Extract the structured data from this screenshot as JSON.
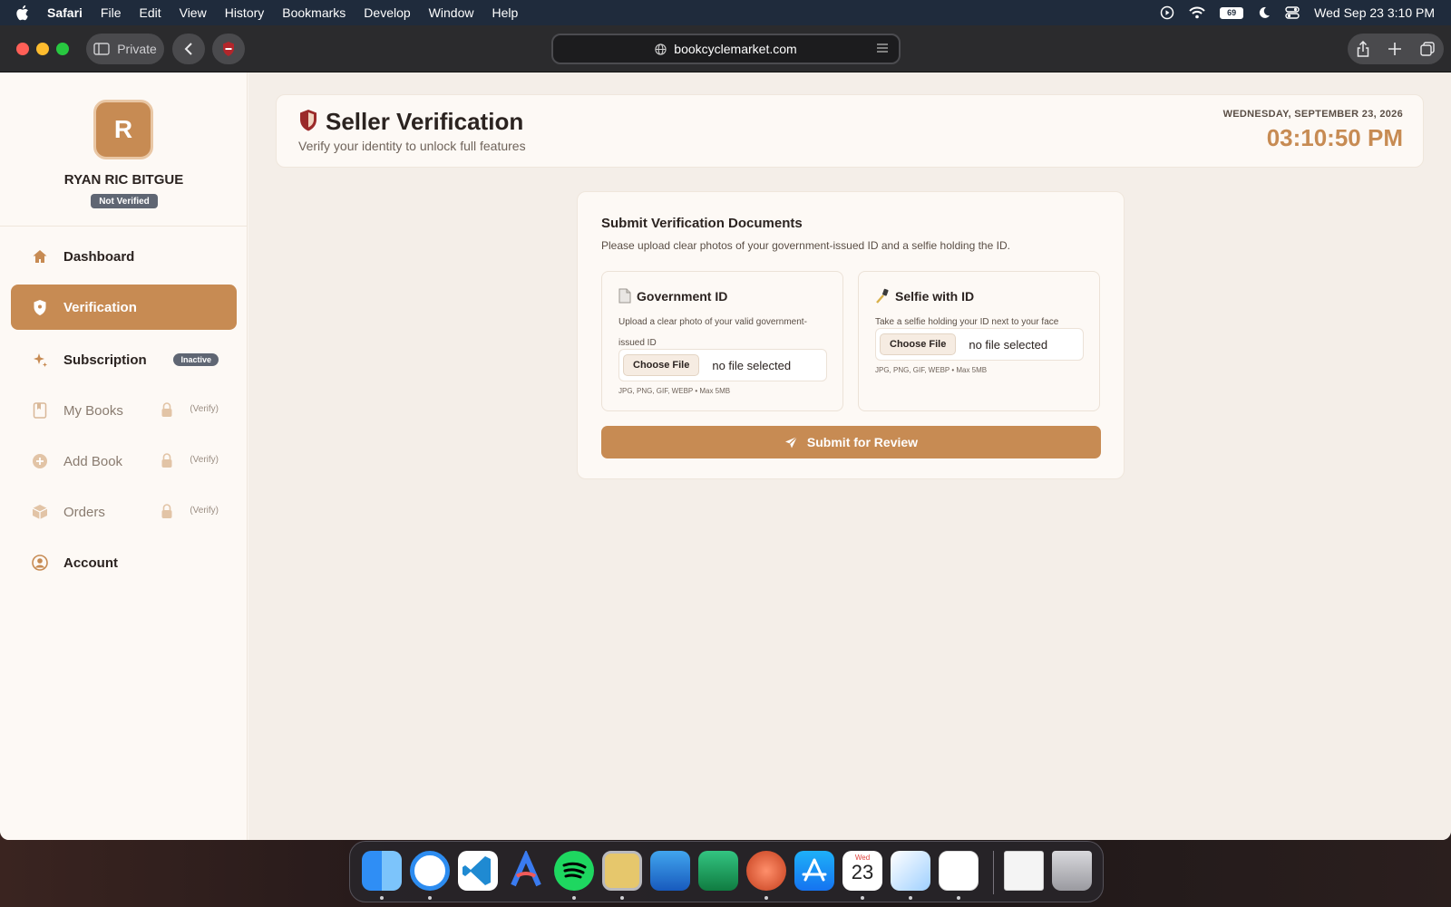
{
  "menubar": {
    "app_name": "Safari",
    "menus": [
      "File",
      "Edit",
      "View",
      "History",
      "Bookmarks",
      "Develop",
      "Window",
      "Help"
    ],
    "battery": "69",
    "clock": "Wed Sep 23  3:10 PM"
  },
  "browser": {
    "private_label": "Private",
    "url": "bookcyclemarket.com"
  },
  "sidebar": {
    "avatar_initial": "R",
    "user_name": "RYAN RIC BITGUE",
    "status_badge": "Not Verified",
    "items": [
      {
        "label": "Dashboard",
        "icon": "home-icon"
      },
      {
        "label": "Verification",
        "icon": "shield-icon"
      },
      {
        "label": "Subscription",
        "icon": "sparkle-icon",
        "tag": "Inactive"
      },
      {
        "label": "My Books",
        "icon": "book-icon",
        "hint": "(Verify)"
      },
      {
        "label": "Add Book",
        "icon": "plus-circle-icon",
        "hint": "(Verify)"
      },
      {
        "label": "Orders",
        "icon": "box-icon",
        "hint": "(Verify)"
      },
      {
        "label": "Account",
        "icon": "user-circle-icon"
      }
    ]
  },
  "header": {
    "title": "Seller Verification",
    "subtitle": "Verify your identity to unlock full features",
    "date": "WEDNESDAY, SEPTEMBER 23, 2026",
    "time": "03:10:50 PM"
  },
  "documents": {
    "title": "Submit Verification Documents",
    "description": "Please upload clear photos of your government-issued ID and a selfie holding the ID.",
    "gov_id": {
      "title": "Government ID",
      "description": "Upload a clear photo of your valid government-issued ID",
      "button": "Choose File",
      "status": "no file selected",
      "hint": "JPG, PNG, GIF, WEBP • Max 5MB"
    },
    "selfie": {
      "title": "Selfie with ID",
      "description": "Take a selfie holding your ID next to your face",
      "button": "Choose File",
      "status": "no file selected",
      "hint": "JPG, PNG, GIF, WEBP • Max 5MB"
    },
    "submit_label": "Submit for Review"
  },
  "dock": {
    "calendar_day_label": "Wed",
    "calendar_day": "23"
  },
  "colors": {
    "accent": "#c78b53",
    "badge_gray": "#5f6673",
    "background": "#f4eee8"
  }
}
